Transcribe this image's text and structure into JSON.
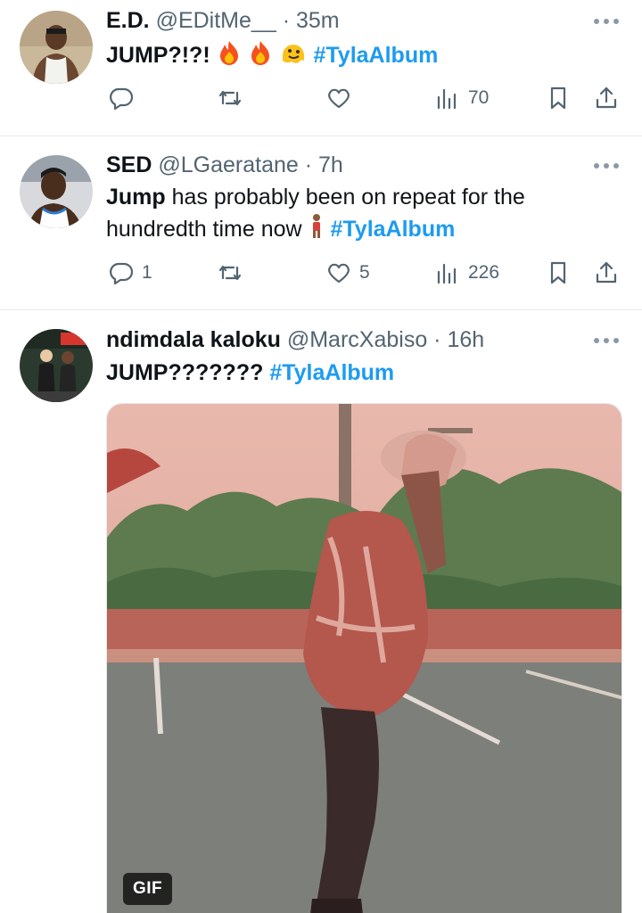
{
  "tweets": [
    {
      "name": "E.D.",
      "handle": "@EDitMe__",
      "separator": "·",
      "time": "35m",
      "text_main": "JUMP?!?! ",
      "hashtag": "#TylaAlbum",
      "emojis": [
        "fire",
        "fire",
        "melting-face"
      ],
      "stats": {
        "replies": "",
        "retweets": "",
        "likes": "",
        "views": "70"
      }
    },
    {
      "name": "SED",
      "handle": "@LGaeratane",
      "separator": "·",
      "time": "7h",
      "text_bold": "Jump",
      "text_rest": " has probably been on repeat for the hundredth time now ",
      "hashtag": "#TylaAlbum",
      "emojis": [
        "person-standing"
      ],
      "stats": {
        "replies": "1",
        "retweets": "",
        "likes": "5",
        "views": "226"
      }
    },
    {
      "name": "ndimdala kaloku",
      "handle": "@MarcXabiso",
      "separator": "·",
      "time": "16h",
      "text_main": "JUMP??????? ",
      "hashtag": "#TylaAlbum",
      "media": {
        "badge": "GIF"
      }
    }
  ],
  "colors": {
    "link": "#1d9bf0",
    "secondary": "#536471",
    "divider": "#e6e9ec"
  },
  "icons": [
    "reply-icon",
    "retweet-icon",
    "like-icon",
    "views-icon",
    "bookmark-icon",
    "share-icon",
    "more-icon"
  ]
}
